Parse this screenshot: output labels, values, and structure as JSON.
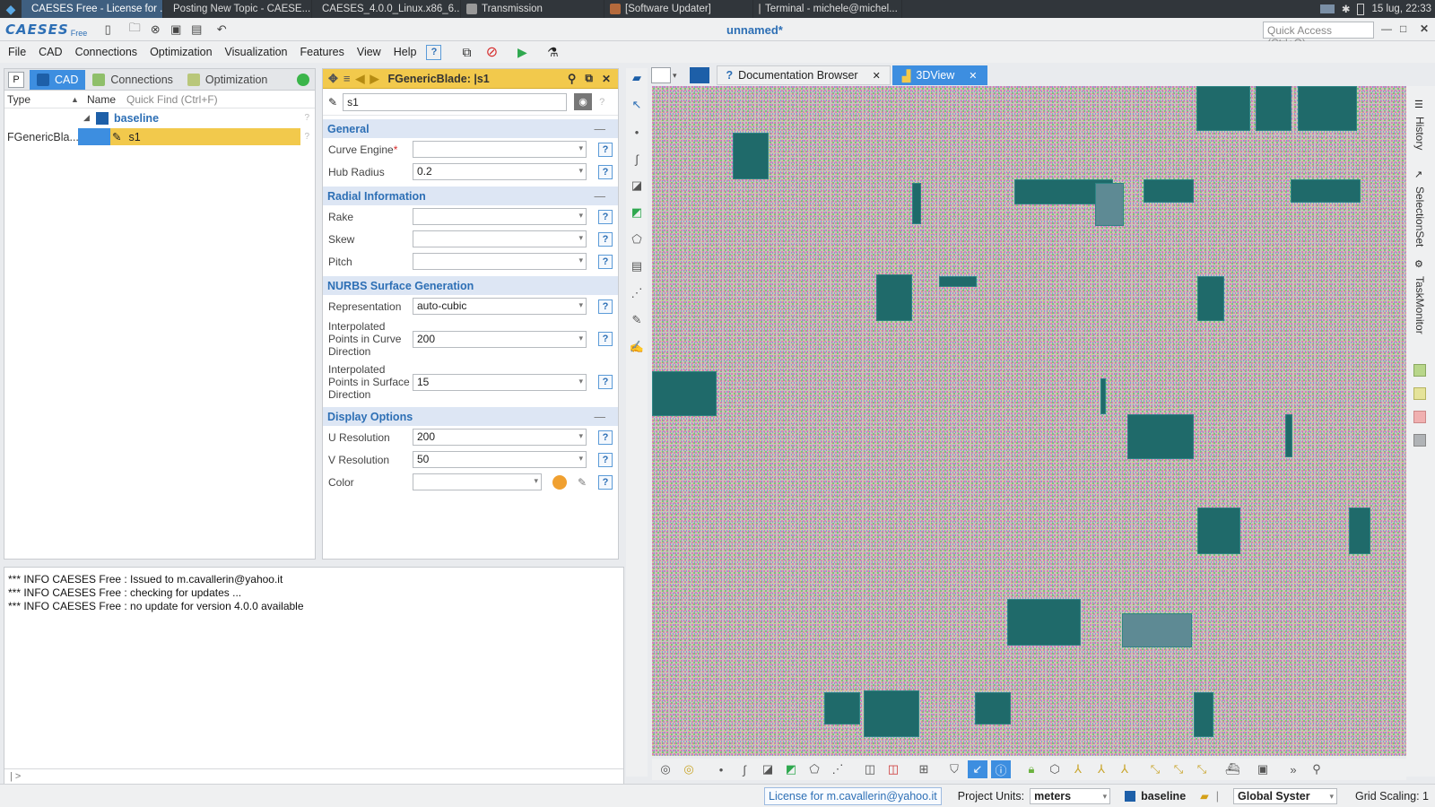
{
  "taskbar": {
    "tasks": [
      {
        "label": "CAESES Free - License for ...",
        "active": true
      },
      {
        "label": "Posting New Topic - CAESE..."
      },
      {
        "label": "CAESES_4.0.0_Linux.x86_6..."
      },
      {
        "label": "Transmission"
      },
      {
        "label": "[Software Updater]"
      },
      {
        "label": "Terminal - michele@michel..."
      }
    ],
    "clock": "15 lug, 22:33"
  },
  "app": {
    "logo": "CAESES",
    "logo_suffix": "Free",
    "doc_title": "unnamed*",
    "quick_access_placeholder": "Quick Access (Ctrl+Q)"
  },
  "menu": [
    "File",
    "CAD",
    "Connections",
    "Optimization",
    "Visualization",
    "Features",
    "View",
    "Help"
  ],
  "left_panel": {
    "p_button": "P",
    "tabs": [
      "CAD",
      "Connections",
      "Optimization"
    ],
    "columns": {
      "type": "Type",
      "name": "Name"
    },
    "quick_find": "Quick Find (Ctrl+F)",
    "tree": {
      "group": "baseline",
      "item_type": "FGenericBla...",
      "item_name": "s1"
    }
  },
  "log": {
    "lines": [
      "*** INFO CAESES Free : Issued to m.cavallerin@yahoo.it",
      "*** INFO CAESES Free : checking for updates ...",
      "*** INFO CAESES Free : no update for version 4.0.0 available"
    ],
    "prompt": "| >"
  },
  "props": {
    "title": "FGenericBlade: |s1",
    "name_value": "s1",
    "sections": {
      "general": "General",
      "radial": "Radial Information",
      "nurbs": "NURBS Surface Generation",
      "display": "Display Options"
    },
    "fields": {
      "curve_engine": {
        "label": "Curve Engine",
        "required": "*",
        "value": ""
      },
      "hub_radius": {
        "label": "Hub Radius",
        "value": "0.2"
      },
      "rake": {
        "label": "Rake",
        "value": ""
      },
      "skew": {
        "label": "Skew",
        "value": ""
      },
      "pitch": {
        "label": "Pitch",
        "value": ""
      },
      "representation": {
        "label": "Representation",
        "value": "auto-cubic"
      },
      "interp_curve": {
        "label": "Interpolated Points in Curve Direction",
        "value": "200"
      },
      "interp_surface": {
        "label": "Interpolated Points in Surface Direction",
        "value": "15"
      },
      "u_resolution": {
        "label": "U Resolution",
        "value": "200"
      },
      "v_resolution": {
        "label": "V Resolution",
        "value": "50"
      },
      "color": {
        "label": "Color",
        "value": ""
      }
    },
    "help_glyph": "?",
    "collapse_glyph": "—"
  },
  "doc_tabs": [
    {
      "label": "Documentation Browser",
      "active": false
    },
    {
      "label": "3DView",
      "active": true
    }
  ],
  "side_labels": [
    "History",
    "SelectionSet",
    "TaskMonitor"
  ],
  "statusbar": {
    "license": "License for m.cavallerin@yahoo.it",
    "project_units_label": "Project Units:",
    "project_units_value": "meters",
    "baseline": "baseline",
    "coord_system": "Global Syster",
    "grid_scaling": "Grid Scaling: 1"
  }
}
